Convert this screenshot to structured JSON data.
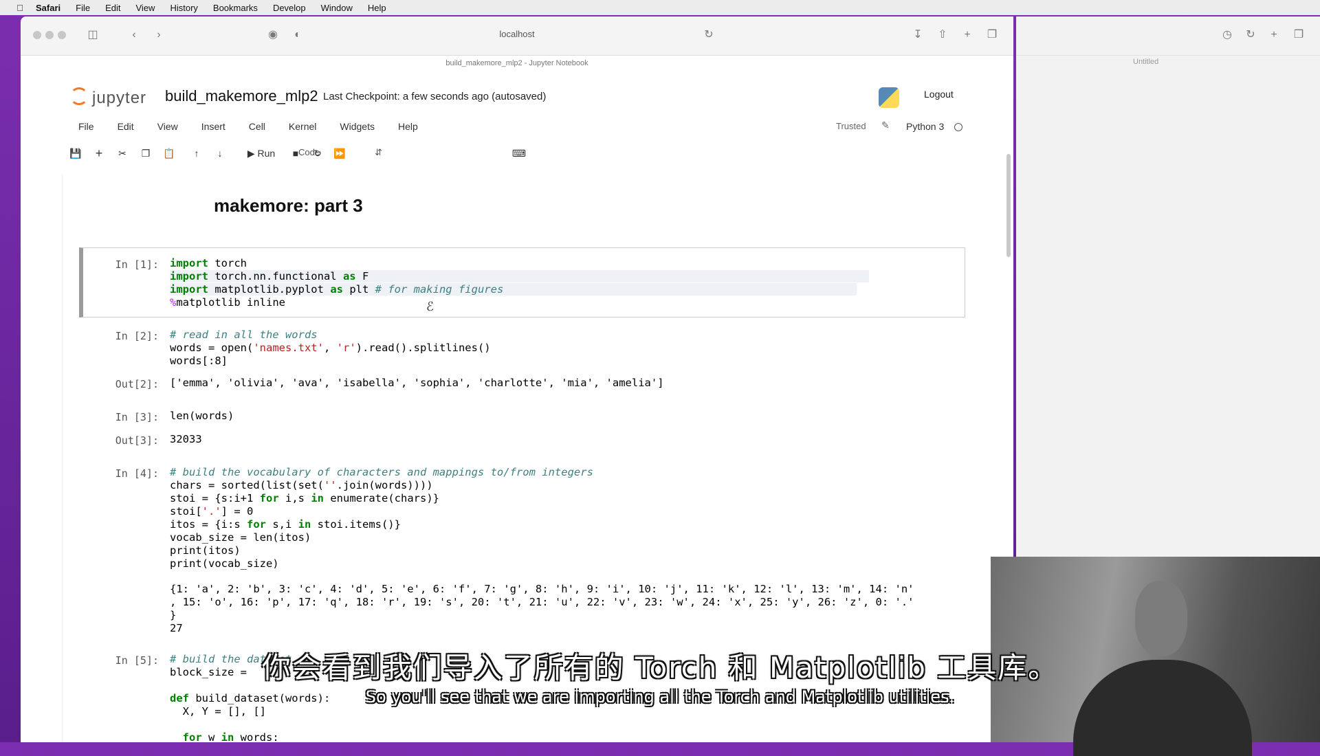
{
  "menubar": {
    "items": [
      "Safari",
      "File",
      "Edit",
      "View",
      "History",
      "Bookmarks",
      "Develop",
      "Window",
      "Help"
    ]
  },
  "browser": {
    "url": "localhost",
    "tab_title": "build_makemore_mlp2 - Jupyter Notebook",
    "right_tab_title": "Untitled"
  },
  "jupyter": {
    "logo_text": "jupyter",
    "notebook_name": "build_makemore_mlp2",
    "checkpoint": "Last Checkpoint: a few seconds ago  (autosaved)",
    "logout": "Logout",
    "menu": [
      "File",
      "Edit",
      "View",
      "Insert",
      "Cell",
      "Kernel",
      "Widgets",
      "Help"
    ],
    "trusted": "Trusted",
    "kernel": "Python 3",
    "run_label": "Run",
    "cell_type": "Code"
  },
  "notebook": {
    "heading": "makemore: part 3",
    "cells": [
      {
        "prompt": "In [1]:",
        "lines": [
          "import torch",
          "import torch.nn.functional as F",
          "import matplotlib.pyplot as plt # for making figures",
          "%matplotlib inline"
        ]
      },
      {
        "prompt": "In [2]:",
        "lines": [
          "# read in all the words",
          "words = open('names.txt', 'r').read().splitlines()",
          "words[:8]"
        ]
      },
      {
        "out_prompt": "Out[2]:",
        "output": "['emma', 'olivia', 'ava', 'isabella', 'sophia', 'charlotte', 'mia', 'amelia']"
      },
      {
        "prompt": "In [3]:",
        "lines": [
          "len(words)"
        ]
      },
      {
        "out_prompt": "Out[3]:",
        "output": "32033"
      },
      {
        "prompt": "In [4]:",
        "lines": [
          "# build the vocabulary of characters and mappings to/from integers",
          "chars = sorted(list(set(''.join(words))))",
          "stoi = {s:i+1 for i,s in enumerate(chars)}",
          "stoi['.'] = 0",
          "itos = {i:s for s,i in stoi.items()}",
          "vocab_size = len(itos)",
          "print(itos)",
          "print(vocab_size)"
        ]
      },
      {
        "output_lines": [
          "{1: 'a', 2: 'b', 3: 'c', 4: 'd', 5: 'e', 6: 'f', 7: 'g', 8: 'h', 9: 'i', 10: 'j', 11: 'k', 12: 'l', 13: 'm', 14: 'n'",
          ", 15: 'o', 16: 'p', 17: 'q', 18: 'r', 19: 's', 20: 't', 21: 'u', 22: 'v', 23: 'w', 24: 'x', 25: 'y', 26: 'z', 0: '.'",
          "}",
          "27"
        ]
      },
      {
        "prompt": "In [5]:",
        "lines": [
          "# build the dataset",
          "block_size = ",
          "",
          "def build_dataset(words):",
          "  X, Y = [], []",
          "",
          "  for w in words:"
        ]
      }
    ]
  },
  "subtitles": {
    "chinese": "你会看到我们导入了所有的 Torch 和 Matplotlib 工具库。",
    "english": "So you'll see that we are importing all the Torch and Matplotlib utilities."
  }
}
